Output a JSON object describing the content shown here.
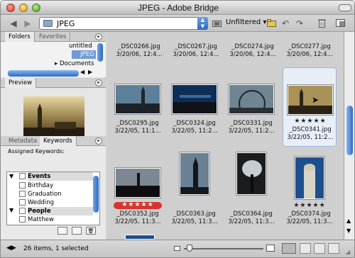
{
  "window": {
    "title": "JPEG - Adobe Bridge"
  },
  "toolbar": {
    "path": "JPEG",
    "filter": "Unfiltered"
  },
  "left": {
    "folders_tab": "Folders",
    "favorites_tab": "Favorites",
    "tree_items": [
      "untitled",
      "JPEG",
      "Documents"
    ],
    "preview_title": "Preview",
    "metadata_tab": "Metadata",
    "keywords_tab": "Keywords",
    "assigned_keywords": "Assigned Keywords:",
    "keywords": [
      {
        "label": "Events",
        "category": true
      },
      {
        "label": "Birthday",
        "category": false
      },
      {
        "label": "Graduation",
        "category": false
      },
      {
        "label": "Wedding",
        "category": false
      },
      {
        "label": "People",
        "category": true
      },
      {
        "label": "Matthew",
        "category": false
      }
    ]
  },
  "thumbnails": [
    {
      "name": "_DSC0266.jpg",
      "date": "3/20/06, 12:4..."
    },
    {
      "name": "_DSC0267.jpg",
      "date": "3/20/06, 12:4..."
    },
    {
      "name": "_DSC0274.jpg",
      "date": "3/20/06, 12:4..."
    },
    {
      "name": "_DSC0277.jpg",
      "date": "3/20/06, 12:4..."
    },
    {
      "name": "_DSC0295.jpg",
      "date": "3/22/05, 11:1..."
    },
    {
      "name": "_DSC0324.jpg",
      "date": "3/22/05, 11:2..."
    },
    {
      "name": "_DSC0331.jpg",
      "date": "3/22/05, 11:2..."
    },
    {
      "name": "_DSC0341.jpg",
      "date": "3/22/05, 11:2...",
      "stars": "★★★★★",
      "selected": true
    },
    {
      "name": "_DSC0352.jpg",
      "date": "3/22/05, 11:3...",
      "stars": "★★★★★",
      "label": "red"
    },
    {
      "name": "_DSC0363.jpg",
      "date": "3/22/05, 11:3..."
    },
    {
      "name": "_DSC0364.jpg",
      "date": "3/22/05, 11:3..."
    },
    {
      "name": "_DSC0374.jpg",
      "date": "3/22/05, 11:3...",
      "stars": "★★★★★"
    }
  ],
  "status": {
    "text": "26 items, 1 selected"
  },
  "colors": {
    "selection": "#e8eef7",
    "red_label": "#d8342e",
    "path_button": "#2c68c1"
  }
}
